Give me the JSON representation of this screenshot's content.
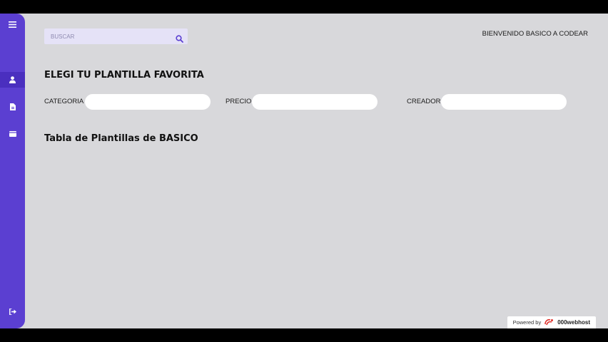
{
  "search": {
    "placeholder": "BUSCAR",
    "icon": "search-icon"
  },
  "header": {
    "welcome": "BIENVENIDO BASICO A CODEAR"
  },
  "sidebar": {
    "items": [
      {
        "icon": "menu-icon"
      },
      {
        "icon": "user-icon",
        "active": true
      },
      {
        "icon": "document-icon"
      },
      {
        "icon": "wallet-icon"
      },
      {
        "icon": "logout-icon"
      }
    ]
  },
  "main": {
    "title": "ELEGI TU PLANTILLA FAVORITA",
    "filters": [
      {
        "label": "CATEGORIA",
        "value": ""
      },
      {
        "label": "PRECIO",
        "value": ""
      },
      {
        "label": "CREADOR",
        "value": ""
      }
    ],
    "table_title": "Tabla de Plantillas de BASICO"
  },
  "footer": {
    "powered_label": "Powered by",
    "brand": "000webhost",
    "brand_icon": "000webhost-logo-icon"
  },
  "colors": {
    "sidebar": "#5b3fd1",
    "background": "#d8d8db",
    "search_bg": "#e5e2f7",
    "accent": "#5b3fd1"
  }
}
